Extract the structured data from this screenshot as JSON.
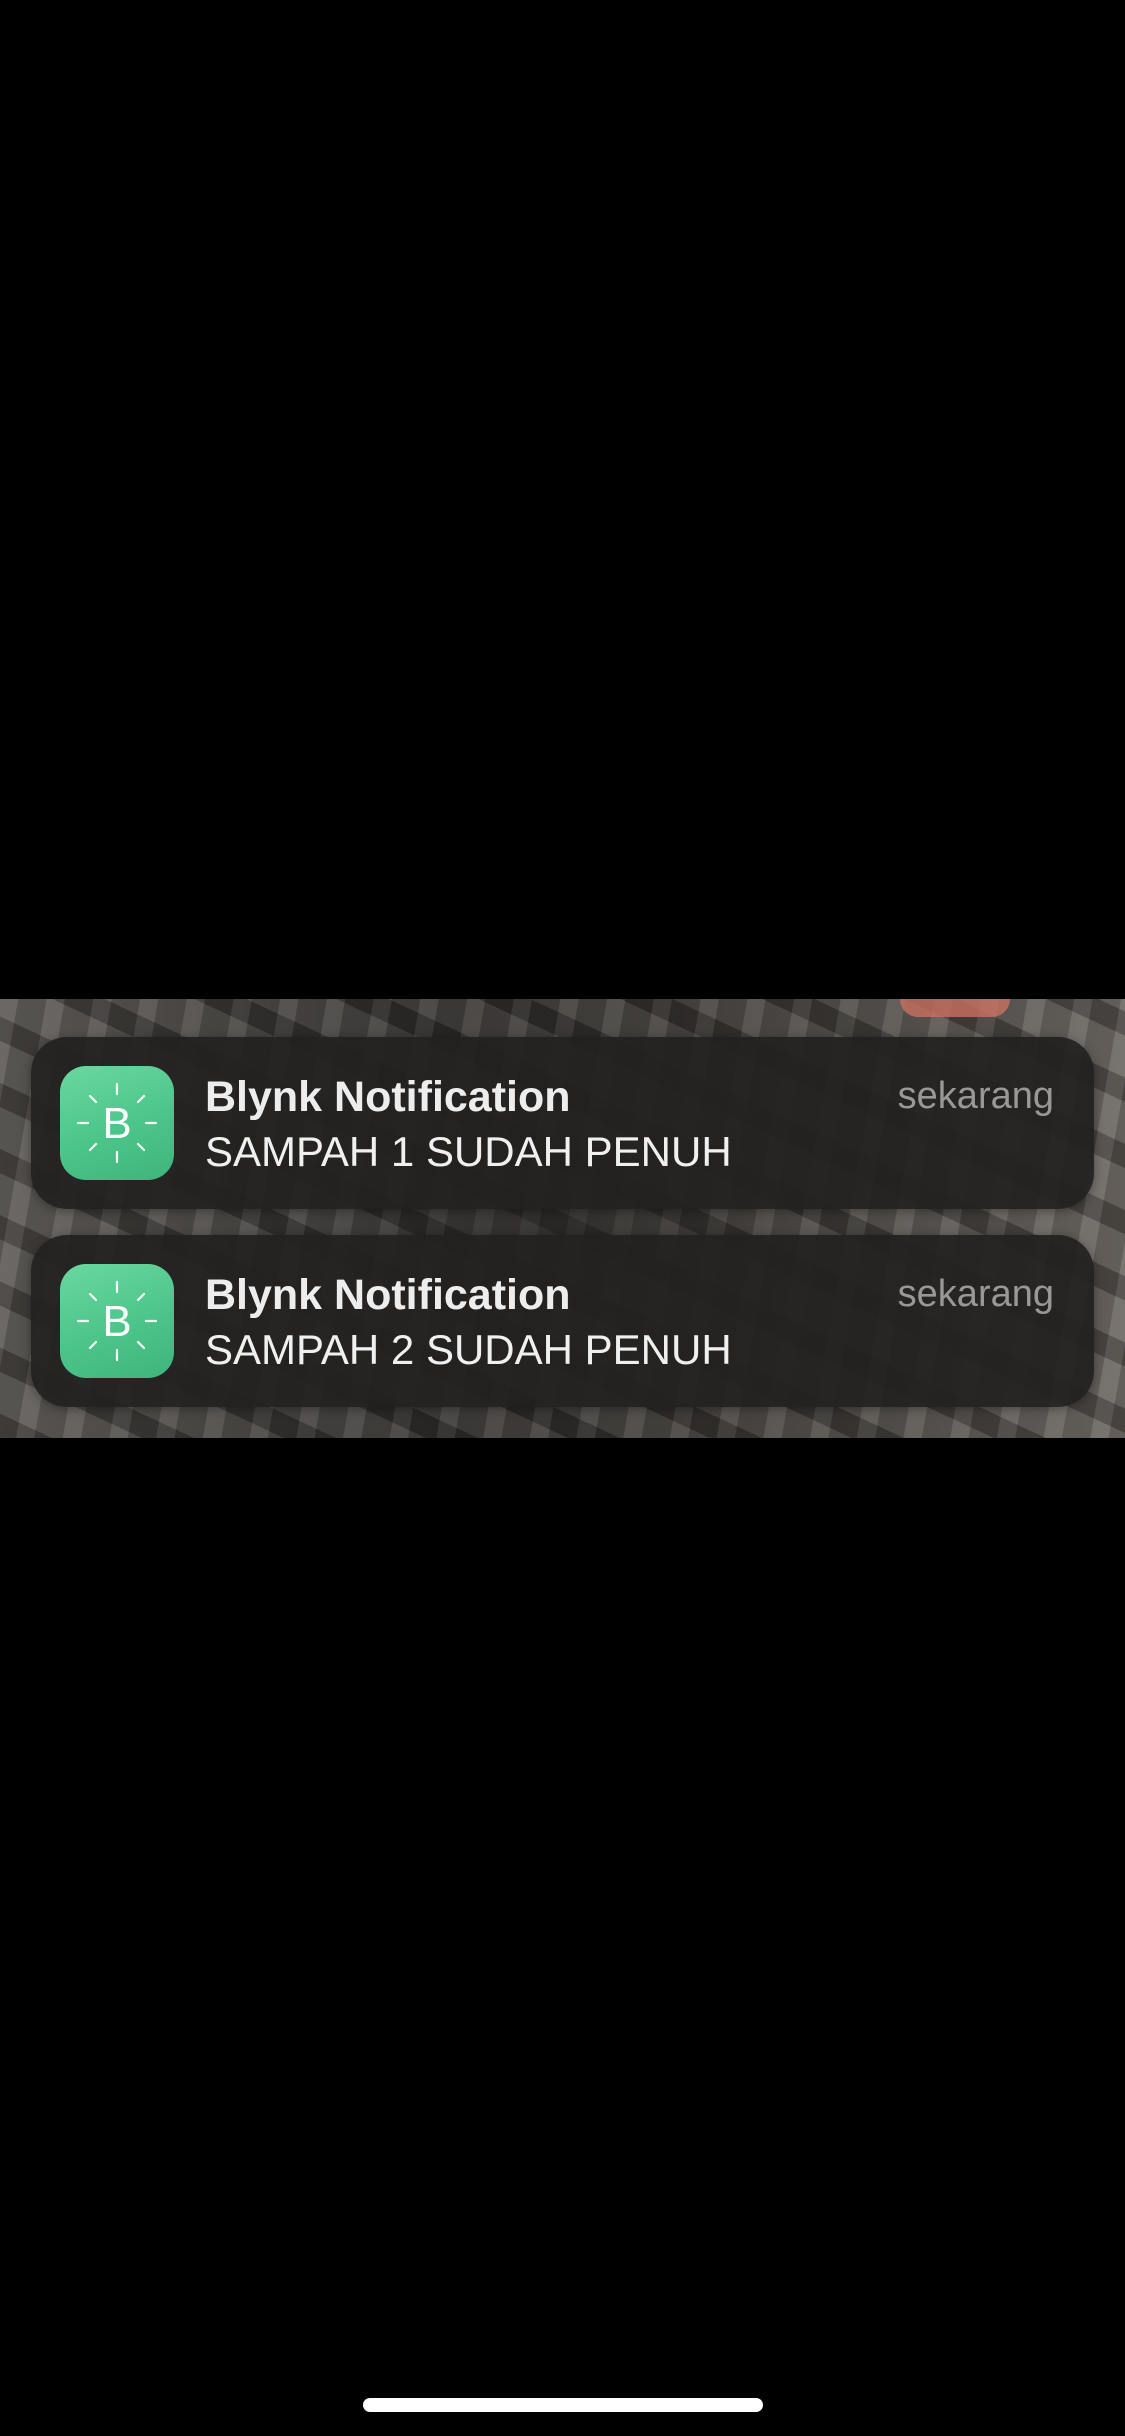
{
  "notifications": [
    {
      "app_name": "Blynk Notification",
      "time": "sekarang",
      "message": "SAMPAH 1 SUDAH PENUH",
      "icon": "blynk-app-icon",
      "icon_letter": "B",
      "icon_color": "#4cc58a"
    },
    {
      "app_name": "Blynk Notification",
      "time": "sekarang",
      "message": "SAMPAH 2 SUDAH PENUH",
      "icon": "blynk-app-icon",
      "icon_letter": "B",
      "icon_color": "#4cc58a"
    }
  ],
  "colors": {
    "background": "#000000",
    "notification_background": "#222120",
    "title_text": "#ededed",
    "time_text": "#9a9896",
    "home_indicator": "#ffffff"
  }
}
